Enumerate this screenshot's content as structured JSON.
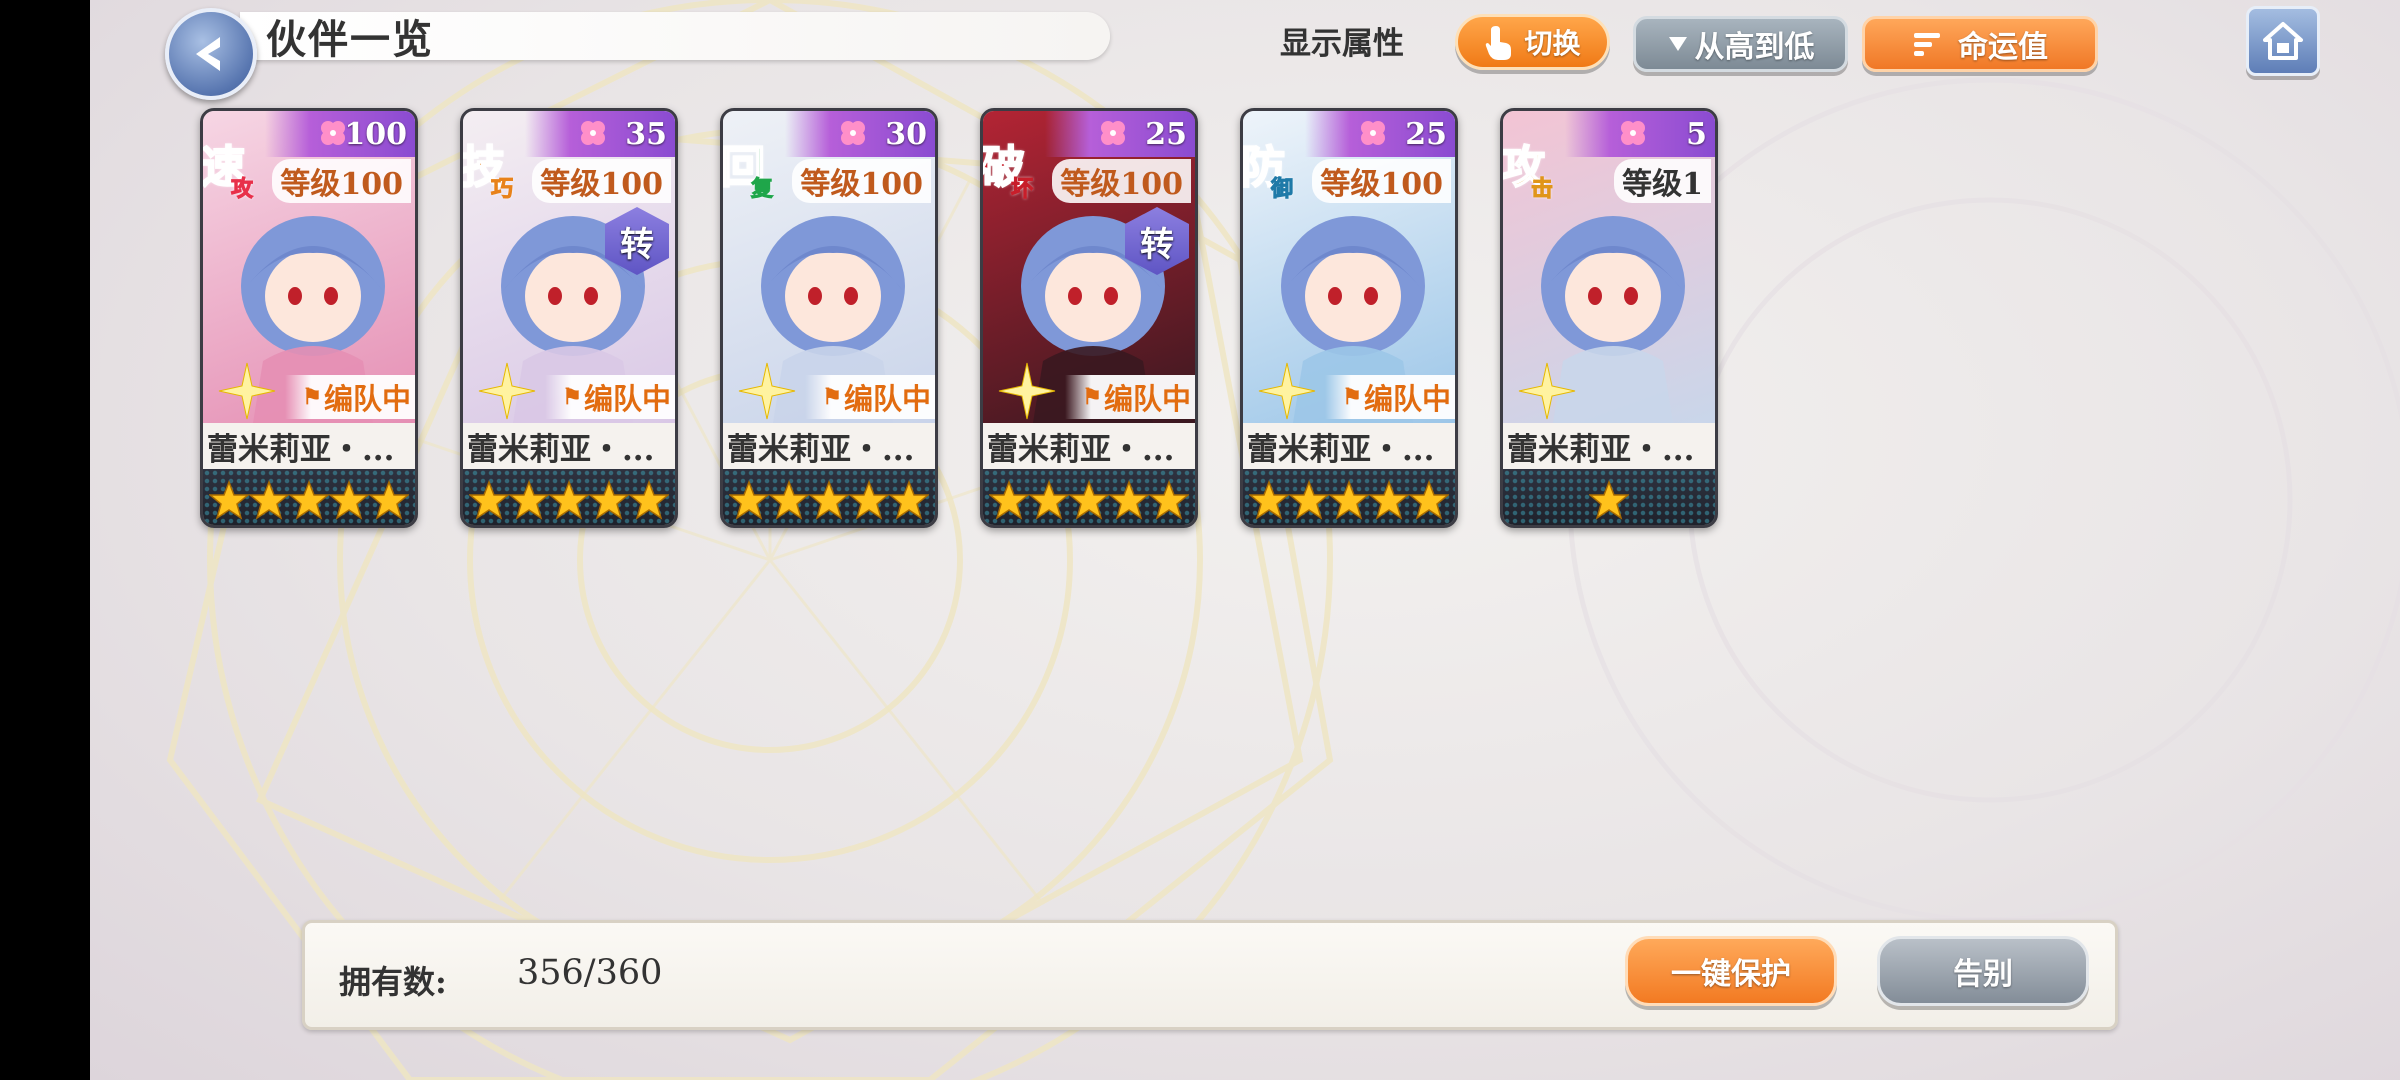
{
  "header": {
    "title": "伙伴一览",
    "attr_label": "显示属性",
    "switch_label": "切换",
    "sort_label": "从高到低",
    "fate_label": "命运值"
  },
  "colors": {
    "accent_orange": "#f07a16",
    "grey_button": "#7d8a95",
    "card_fate": "#b65fd9",
    "star_gold": "#ffc21c"
  },
  "cards": [
    {
      "attr": "速",
      "attr_sub": "攻",
      "attr_color": "#e8304a",
      "fate": "100",
      "level": "等级100",
      "converted": false,
      "in_team": true,
      "team_label": "编队中",
      "name": "蕾米莉亚・...",
      "stars": 5,
      "palette": [
        "#f6d6e4",
        "#e58fb4"
      ]
    },
    {
      "attr": "技",
      "attr_sub": "巧",
      "attr_color": "#e8821a",
      "fate": "35",
      "level": "等级100",
      "converted": true,
      "convert_label": "转",
      "in_team": true,
      "team_label": "编队中",
      "name": "蕾米莉亚・...",
      "stars": 5,
      "palette": [
        "#f4eef2",
        "#d9c8e6"
      ]
    },
    {
      "attr": "回",
      "attr_sub": "复",
      "attr_color": "#1fa64a",
      "fate": "30",
      "level": "等级100",
      "converted": false,
      "in_team": true,
      "team_label": "编队中",
      "name": "蕾米莉亚・...",
      "stars": 5,
      "palette": [
        "#eef1f6",
        "#c9d4ea"
      ]
    },
    {
      "attr": "破",
      "attr_sub": "坏",
      "attr_color": "#c81e2a",
      "fate": "25",
      "level": "等级100",
      "converted": true,
      "convert_label": "转",
      "in_team": true,
      "team_label": "编队中",
      "name": "蕾米莉亚・...",
      "stars": 5,
      "palette": [
        "#b32434",
        "#3a1820"
      ]
    },
    {
      "attr": "防",
      "attr_sub": "御",
      "attr_color": "#1f7aa8",
      "fate": "25",
      "level": "等级100",
      "converted": false,
      "in_team": true,
      "team_label": "编队中",
      "name": "蕾米莉亚・...",
      "stars": 5,
      "palette": [
        "#eef4fa",
        "#9cc6e8"
      ]
    },
    {
      "attr": "攻",
      "attr_sub": "击",
      "attr_color": "#e0951a",
      "fate": "5",
      "level": "等级1",
      "converted": false,
      "in_team": false,
      "team_label": "",
      "name": "蕾米莉亚・...",
      "stars": 1,
      "palette": [
        "#f3c4d4",
        "#c9d6ea"
      ]
    }
  ],
  "footer": {
    "owned_label": "拥有数:",
    "owned_value": "356/360",
    "protect_label": "一键保护",
    "farewell_label": "告别"
  }
}
